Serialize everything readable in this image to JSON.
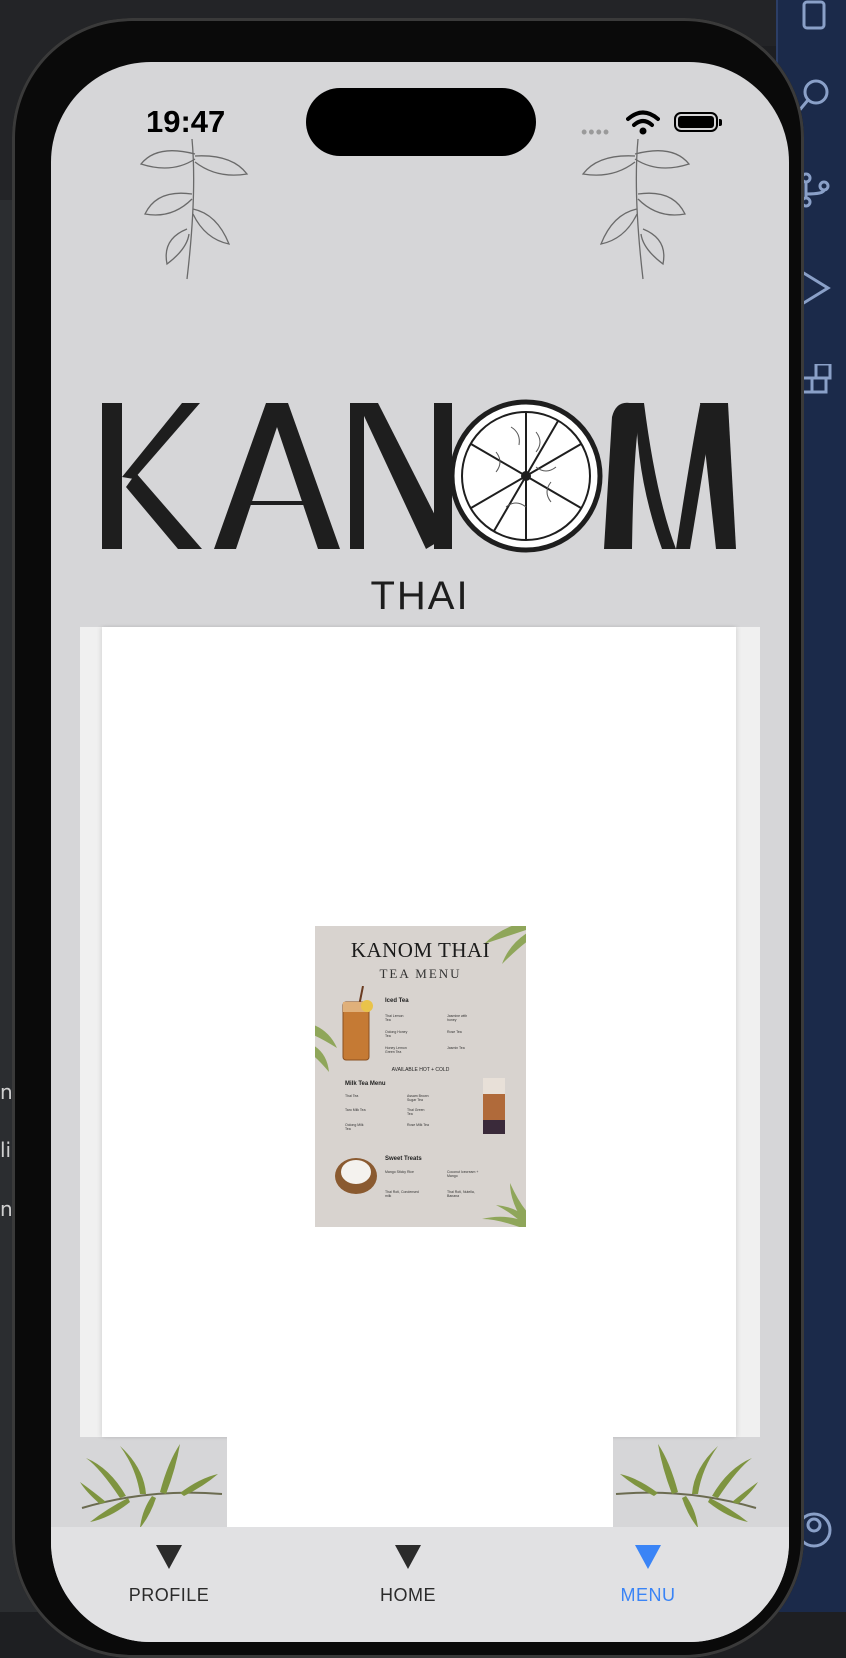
{
  "status_bar": {
    "time": "19:47",
    "signal": "••••"
  },
  "brand": {
    "logo_text": "KANOM",
    "subtitle": "THAI"
  },
  "menu_image": {
    "title": "KANOM THAI",
    "subtitle": "TEA MENU",
    "sections": [
      {
        "name": "Iced Tea",
        "items": [
          "Thai Lemon Tea",
          "Oolong Honey Tea",
          "Honey Lemon Green Tea",
          "Jasmine with honey",
          "Rose Tea",
          "Jasmin Tea"
        ]
      },
      {
        "name": "Milk Tea Menu",
        "items": [
          "Thai Tea",
          "Taro Milk Tea",
          "Oolong Milk Tea",
          "Assam Brown Sugar Tea",
          "Thai Green Tea",
          "Rose Milk Tea"
        ]
      },
      {
        "name": "Sweet Treats",
        "items": [
          "Mango Sticky Rice",
          "Coconut Icecream + Mango",
          "Thai Roti, Condensed milk",
          "Thai Roti, Nutella, Banana"
        ]
      }
    ],
    "note": "AVAILABLE HOT + COLD"
  },
  "tabs": [
    {
      "label": "PROFILE",
      "active": false
    },
    {
      "label": "HOME",
      "active": false
    },
    {
      "label": "MENU",
      "active": true
    }
  ],
  "colors": {
    "accent": "#3a84f6",
    "screen_bg": "#d6d6d8",
    "tab_bg": "#e1e1e3"
  },
  "ide_fragments": {
    "left_1": "n",
    "left_2": "li",
    "left_3": "n"
  }
}
